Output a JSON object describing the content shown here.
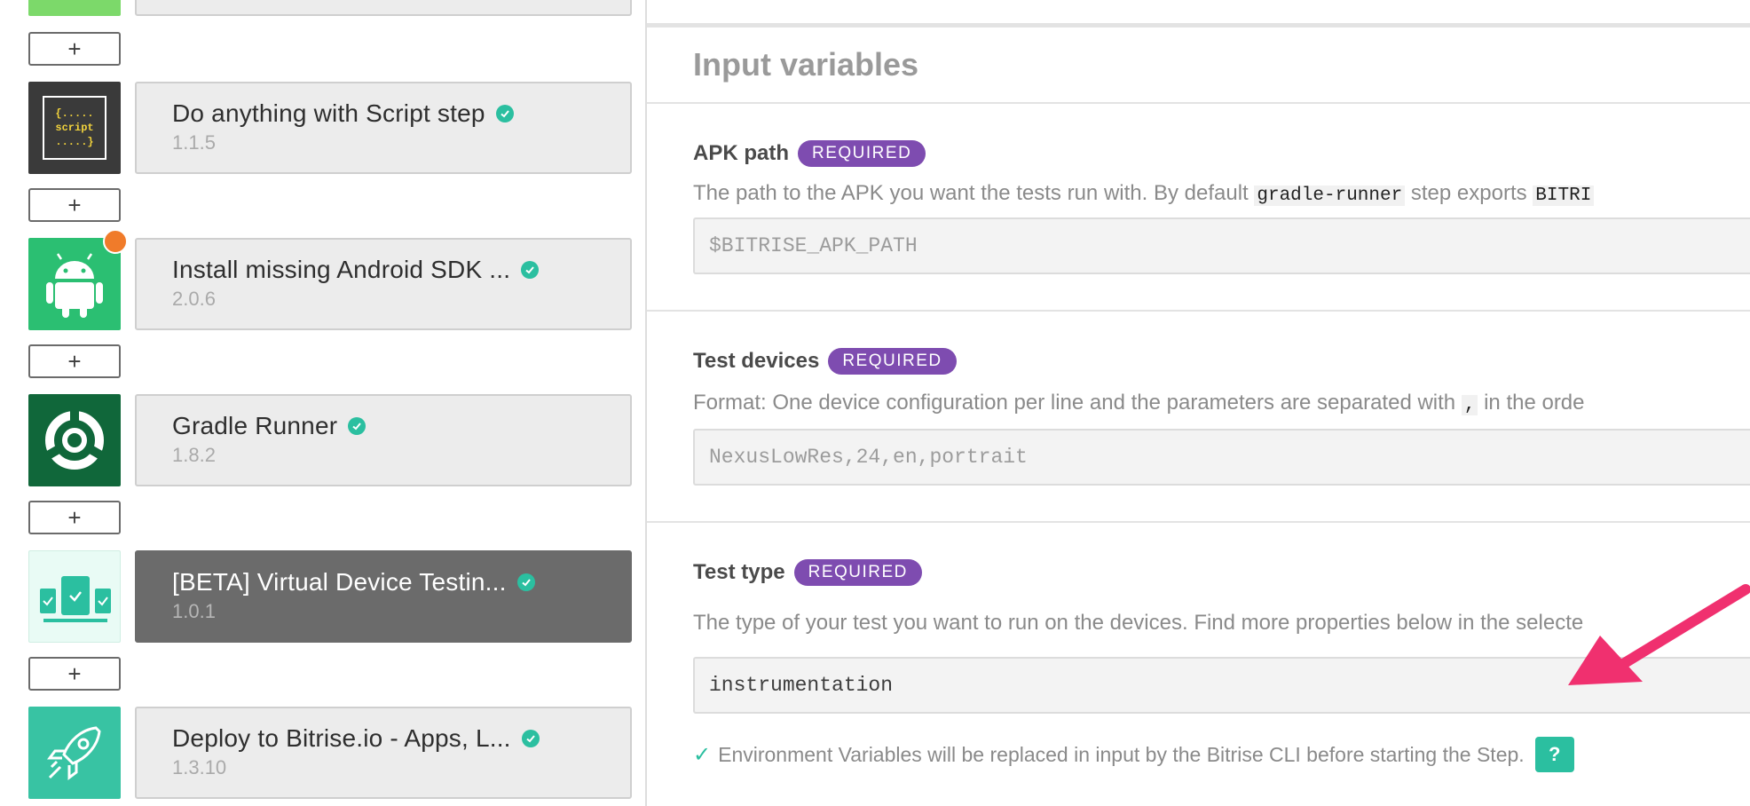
{
  "steps": [
    {
      "title": "Do anything with Script step",
      "version": "1.1.5",
      "icon": "script-icon",
      "selected": false
    },
    {
      "title": "Install missing Android SDK ...",
      "version": "2.0.6",
      "icon": "android-icon",
      "selected": false
    },
    {
      "title": "Gradle Runner",
      "version": "1.8.2",
      "icon": "gradle-icon",
      "selected": false
    },
    {
      "title": "[BETA] Virtual Device Testin...",
      "version": "1.0.1",
      "icon": "virtual-device-icon",
      "selected": true
    },
    {
      "title": "Deploy to Bitrise.io - Apps, L...",
      "version": "1.3.10",
      "icon": "rocket-icon",
      "selected": false
    }
  ],
  "add_label": "+",
  "script_icon_lines": [
    "{.....",
    "script",
    ".....}"
  ],
  "inputs_title": "Input variables",
  "required_label": "REQUIRED",
  "inputs": [
    {
      "label": "APK path",
      "desc_before": "The path to the APK you want the tests run with. By default ",
      "desc_code": "gradle-runner",
      "desc_after": " step exports ",
      "desc_code2": "BITRI",
      "value": "$BITRISE_APK_PATH"
    },
    {
      "label": "Test devices",
      "desc_before": "Format: One device configuration per line and the parameters are separated with ",
      "desc_code": ",",
      "desc_after": " in the orde",
      "value": "NexusLowRes,24,en,portrait"
    },
    {
      "label": "Test type",
      "desc_before": "The type of your test you want to run on the devices. Find more properties below in the selecte",
      "value": "instrumentation"
    }
  ],
  "env_note": "Environment Variables will be replaced in input by the Bitrise CLI before starting the Step.",
  "help_label": "?",
  "colors": {
    "required_badge": "#7e4cb0",
    "verified": "#2bbfa0",
    "annotation_arrow": "#f0306f",
    "android_bg": "#2bbf72",
    "gradle_bg": "#10673a",
    "deploy_bg": "#38c3a3"
  }
}
